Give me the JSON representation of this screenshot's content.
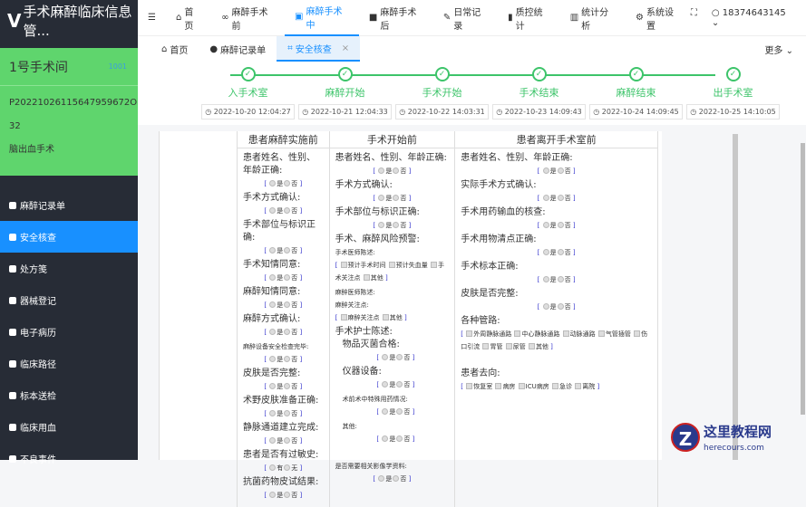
{
  "app": {
    "title": "手术麻醉临床信息管...",
    "logo": "V"
  },
  "room": {
    "name": "1号手术间",
    "code": "1001",
    "patient_id": "P20221026115647959672O",
    "age": "32",
    "surgery": "脑出血手术"
  },
  "menu": [
    {
      "label": "麻醉记录单"
    },
    {
      "label": "安全核查"
    },
    {
      "label": "处方笺"
    },
    {
      "label": "器械登记"
    },
    {
      "label": "电子病历"
    },
    {
      "label": "临床路径"
    },
    {
      "label": "标本送检"
    },
    {
      "label": "临床用血"
    },
    {
      "label": "不良事件"
    }
  ],
  "nav": [
    {
      "label": "首页"
    },
    {
      "label": "麻醉手术前"
    },
    {
      "label": "麻醉手术中"
    },
    {
      "label": "麻醉手术后"
    },
    {
      "label": "日常记录"
    },
    {
      "label": "质控统计"
    },
    {
      "label": "统计分析"
    },
    {
      "label": "系统设置"
    }
  ],
  "user": "18374643145",
  "tabs": [
    {
      "label": "首页"
    },
    {
      "label": "麻醉记录单"
    },
    {
      "label": "安全核查"
    }
  ],
  "more": "更多",
  "steps": [
    {
      "label": "入手术室",
      "time": "2022-10-20 12:04:27"
    },
    {
      "label": "麻醉开始",
      "time": "2022-10-21 12:04:33"
    },
    {
      "label": "手术开始",
      "time": "2022-10-22 14:03:31"
    },
    {
      "label": "手术结束",
      "time": "2022-10-23 14:09:43"
    },
    {
      "label": "麻醉结束",
      "time": "2022-10-24 14:09:45"
    },
    {
      "label": "出手术室",
      "time": "2022-10-25 14:10:05"
    }
  ],
  "form": {
    "headers": [
      "患者麻醉实施前",
      "手术开始前",
      "患者离开手术室前"
    ],
    "yes": "是",
    "no": "否",
    "have": "有",
    "none": "无",
    "c1": [
      "患者姓名、性别、年龄正确:",
      "手术方式确认:",
      "手术部位与标识正确:",
      "手术知情同意:",
      "麻醉知情同意:",
      "麻醉方式确认:",
      "麻醉设备安全检查完毕:",
      "皮肤是否完整:",
      "术野皮肤准备正确:",
      "静脉通道建立完成:",
      "患者是否有过敏史:",
      "抗菌药物皮试结果:"
    ],
    "c2": {
      "q1": "患者姓名、性别、年龄正确:",
      "q2": "手术方式确认:",
      "q3": "手术部位与标识正确:",
      "q4": "手术、麻醉风险预警:",
      "q5": "手术医师陈述:",
      "o5": [
        "预计手术时间",
        "预计失血量",
        "手术关注点",
        "其他"
      ],
      "q6": "麻醉医师陈述:",
      "q6b": "麻醉关注点:",
      "o6": [
        "麻醉关注点",
        "其他"
      ],
      "q7": "手术护士陈述:",
      "q8": "物品灭菌合格:",
      "q9": "仪器设备:",
      "q10": "术前术中特殊用药情况:",
      "q11": "其他:",
      "q12": "是否需要相关影像学资料:"
    },
    "c3": {
      "q": [
        "患者姓名、性别、年龄正确:",
        "实际手术方式确认:",
        "手术用药输血的核查:",
        "手术用物清点正确:",
        "手术标本正确:",
        "皮肤是否完整:"
      ],
      "tubes": "各种管路:",
      "o_tubes": [
        "外周静脉通路",
        "中心静脉通路",
        "动脉通路",
        "气管插管",
        "伤口引流",
        "胃管",
        "尿管",
        "其他"
      ],
      "dest": "患者去向:",
      "o_dest": [
        "恢复室",
        "病房",
        "ICU病房",
        "急诊",
        "离院"
      ]
    }
  },
  "watermark": {
    "cn": "这里教程网",
    "en": "herecours.com"
  }
}
